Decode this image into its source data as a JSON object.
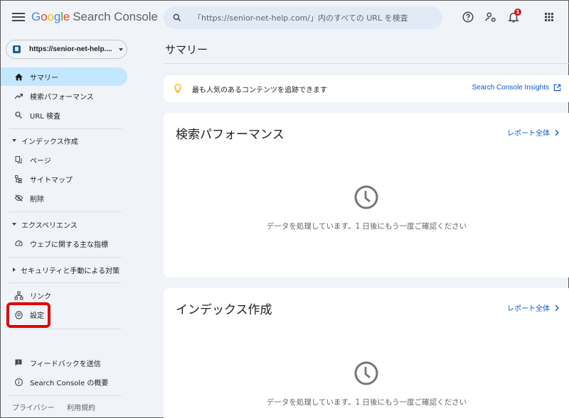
{
  "header": {
    "app_name_google": "Google",
    "app_name_product": "Search Console",
    "search_placeholder": "「https://senior-net-help.com/」内のすべての URL を検査",
    "notification_count": "1",
    "icons": [
      "menu-icon",
      "search-icon",
      "help-icon",
      "manage-users-icon",
      "notifications-icon",
      "apps-grid-icon"
    ]
  },
  "sidebar": {
    "property_label": "https://senior-net-help....",
    "items": [
      {
        "label": "サマリー",
        "icon": "home-icon",
        "active": true
      },
      {
        "label": "検索パフォーマンス",
        "icon": "trending-up-icon"
      },
      {
        "label": "URL 検査",
        "icon": "search-icon"
      }
    ],
    "sections": [
      {
        "label": "インデックス作成",
        "expanded": true,
        "items": [
          {
            "label": "ページ",
            "icon": "pages-icon"
          },
          {
            "label": "サイトマップ",
            "icon": "sitemap-icon"
          },
          {
            "label": "削除",
            "icon": "visibility-off-icon"
          }
        ]
      },
      {
        "label": "エクスペリエンス",
        "expanded": true,
        "items": [
          {
            "label": "ウェブに関する主な指標",
            "icon": "speed-icon"
          }
        ]
      },
      {
        "label": "セキュリティと手動による対策",
        "expanded": false,
        "items": []
      }
    ],
    "bottom_items": [
      {
        "label": "リンク",
        "icon": "links-icon"
      },
      {
        "label": "設定",
        "icon": "gear-icon",
        "highlighted": true
      }
    ],
    "footer_items": [
      {
        "label": "フィードバックを送信",
        "icon": "feedback-icon"
      },
      {
        "label": "Search Console の概要",
        "icon": "info-icon"
      }
    ],
    "footer_links": [
      "プライバシー",
      "利用規約"
    ]
  },
  "main": {
    "title": "サマリー",
    "insight": {
      "text": "最も人気のあるコンテンツを追跡できます",
      "link_label": "Search Console Insights"
    },
    "cards": [
      {
        "title": "検索パフォーマンス",
        "link_label": "レポート全体",
        "message": "データを処理しています。1 日後にもう一度ご確認ください"
      },
      {
        "title": "インデックス作成",
        "link_label": "レポート全体",
        "message": "データを処理しています。1 日後にもう一度ご確認ください"
      }
    ]
  },
  "colors": {
    "background": "#f0f4f9",
    "active_nav": "#c2e7ff",
    "link": "#0b57d0",
    "highlight_box": "#e00000",
    "badge": "#c5221f"
  }
}
